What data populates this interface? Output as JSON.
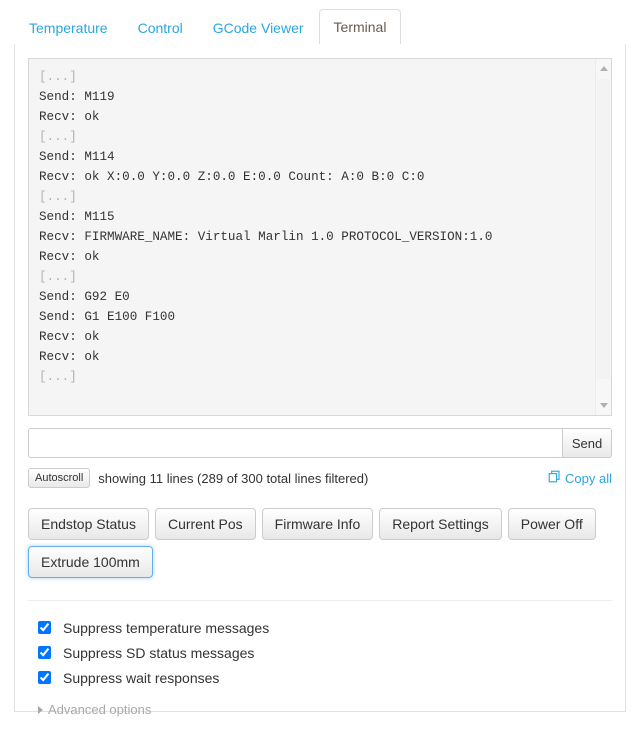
{
  "tabs": [
    {
      "label": "Temperature",
      "active": false
    },
    {
      "label": "Control",
      "active": false
    },
    {
      "label": "GCode Viewer",
      "active": false
    },
    {
      "label": "Terminal",
      "active": true
    }
  ],
  "terminal": {
    "lines": [
      {
        "text": "[...]",
        "muted": true
      },
      {
        "text": "Send: M119",
        "muted": false
      },
      {
        "text": "Recv: ok",
        "muted": false
      },
      {
        "text": "[...]",
        "muted": true
      },
      {
        "text": "Send: M114",
        "muted": false
      },
      {
        "text": "Recv: ok X:0.0 Y:0.0 Z:0.0 E:0.0 Count: A:0 B:0 C:0",
        "muted": false
      },
      {
        "text": "[...]",
        "muted": true
      },
      {
        "text": "Send: M115",
        "muted": false
      },
      {
        "text": "Recv: FIRMWARE_NAME: Virtual Marlin 1.0 PROTOCOL_VERSION:1.0",
        "muted": false
      },
      {
        "text": "Recv: ok",
        "muted": false
      },
      {
        "text": "[...]",
        "muted": true
      },
      {
        "text": "Send: G92 E0",
        "muted": false
      },
      {
        "text": "Send: G1 E100 F100",
        "muted": false
      },
      {
        "text": "Recv: ok",
        "muted": false
      },
      {
        "text": "Recv: ok",
        "muted": false
      },
      {
        "text": "[...]",
        "muted": true
      }
    ]
  },
  "command_input": {
    "value": "",
    "placeholder": "",
    "send_label": "Send"
  },
  "status": {
    "autoscroll_label": "Autoscroll",
    "text": "showing 11 lines (289 of 300 total lines filtered)",
    "copy_all_label": "Copy all"
  },
  "command_buttons": [
    {
      "label": "Endstop Status",
      "focused": false
    },
    {
      "label": "Current Pos",
      "focused": false
    },
    {
      "label": "Firmware Info",
      "focused": false
    },
    {
      "label": "Report Settings",
      "focused": false
    },
    {
      "label": "Power Off",
      "focused": false
    },
    {
      "label": "Extrude 100mm",
      "focused": true
    }
  ],
  "filters": [
    {
      "label": "Suppress temperature messages",
      "checked": true
    },
    {
      "label": "Suppress SD status messages",
      "checked": true
    },
    {
      "label": "Suppress wait responses",
      "checked": true
    }
  ],
  "advanced": {
    "label": "Advanced options"
  },
  "colors": {
    "link": "#2ba6e0",
    "active_tab_text": "#6b5a4e",
    "muted_text": "#b3b3b3",
    "terminal_bg": "#f5f5f5",
    "focus_ring": "#66afe9"
  }
}
